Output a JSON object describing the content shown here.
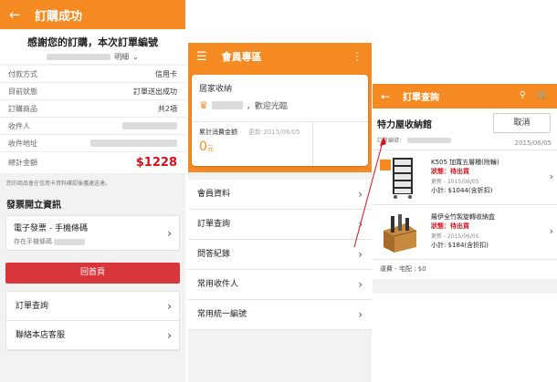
{
  "screen1": {
    "title": "訂購成功",
    "back_icon": "arrow-left-icon",
    "thanks": "感謝您的訂購，本次訂單編號",
    "detail_label": "明細",
    "rows": [
      {
        "key": "付款方式",
        "value": "信用卡"
      },
      {
        "key": "目前狀態",
        "value": "訂單送出成功"
      },
      {
        "key": "訂購商品",
        "value": "共2項"
      },
      {
        "key": "收件人",
        "value": ""
      },
      {
        "key": "收件地址",
        "value": ""
      }
    ],
    "total_label": "總計金額",
    "total_value": "$1228",
    "note": "您的商品會在信用卡資料確認後儘速送達。",
    "invoice_section": "發票開立資訊",
    "invoice_title": "電子發票 - 手機條碼",
    "invoice_sub": "存在手機條碼",
    "home_button": "回首頁",
    "menu": [
      "訂單查詢",
      "聯絡本店客服"
    ]
  },
  "screen2": {
    "title": "會員專區",
    "store": "居家收納",
    "welcome": "，歡迎光臨",
    "spend_label": "累計消費金額",
    "updated": "更新:2015/06/05",
    "amount": "0",
    "unit": "元",
    "menu": [
      "會員資料",
      "訂單查詢",
      "問答紀錄",
      "常用收件人",
      "常用統一編號"
    ]
  },
  "screen3": {
    "title": "訂單查詢",
    "store": "特力屋收納館",
    "cancel": "取消",
    "order_label": "訂單編號：",
    "date": "2015/06/05",
    "items": [
      {
        "name": "K505 加寬五層櫃(附輪)",
        "status": "狀態：待出貨",
        "updated": "更新 - 2015/06/05",
        "subtotal": "小計: $1044(含折扣)"
      },
      {
        "name": "羅伊全竹製旋轉收納盒",
        "status": "狀態：待出貨",
        "updated": "更新 - 2015/06/05",
        "subtotal": "小計: $184(含折扣)"
      }
    ],
    "shipping": "運費 - 宅配 : $0"
  },
  "colors": {
    "accent": "#f58a22",
    "price_red": "#d6101a",
    "home_button": "#d8363a"
  }
}
